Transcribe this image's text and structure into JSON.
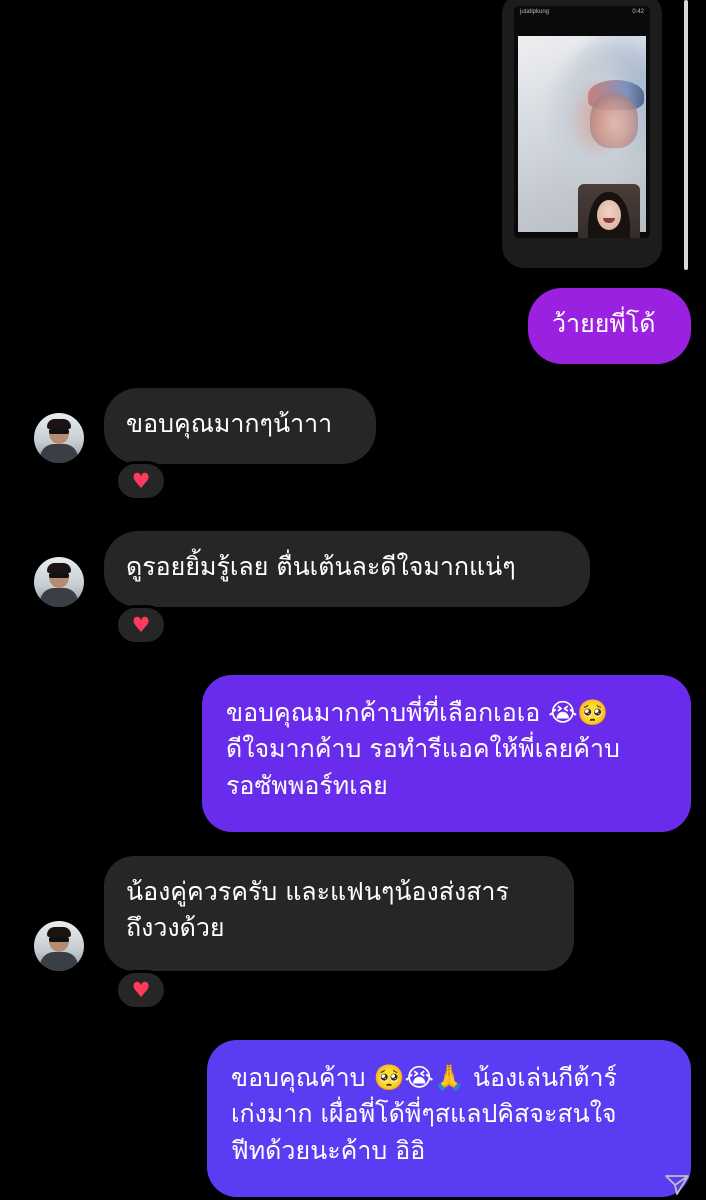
{
  "story": {
    "username": "jutatipkung",
    "duration": "0:42"
  },
  "messages": [
    {
      "id": "m1",
      "direction": "sent",
      "text_lines": [
        "ว้ายยพี่โด้"
      ]
    },
    {
      "id": "m2",
      "direction": "received",
      "text_lines": [
        "ขอบคุณมากๆน้าาา"
      ],
      "reaction": "♥"
    },
    {
      "id": "m3",
      "direction": "received",
      "text_lines": [
        "ดูรอยยิ้มรู้เลย ตื่นเต้นละดีใจมากแน่ๆ"
      ],
      "reaction": "♥"
    },
    {
      "id": "m4",
      "direction": "sent",
      "text_lines": [
        "ขอบคุณมากค้าบพี่ที่เลือกเอเอ 😭🥺",
        "ดีใจมากค้าบ รอทำรีแอคให้พี่เลยค้าบ",
        "รอซัพพอร์ทเลย"
      ]
    },
    {
      "id": "m5",
      "direction": "received",
      "text_lines": [
        "น้องคู่ควรครับ และแฟนๆน้องส่งสาร",
        "ถึงวงด้วย"
      ],
      "reaction": "♥"
    },
    {
      "id": "m6",
      "direction": "sent",
      "text_lines": [
        "ขอบคุณค้าบ 🥺😭🙏 น้องเล่นกีต้าร์",
        "เก่งมาก เผื่อพี่โด้พี่ๆสแลปคิสจะสนใจ",
        "ฟีทด้วยนะค้าบ อิอิ"
      ]
    }
  ],
  "colors": {
    "background": "#000000",
    "received_bubble": "#262626",
    "sent_pink": "#9a21e0",
    "sent_purple": "#6a2cec",
    "sent_blue": "#5a3cf2",
    "reaction_heart": "#ff3b5c"
  },
  "icons": {
    "reaction": "heart-icon",
    "seen": "send-arrow-icon",
    "avatar": "user-avatar"
  }
}
